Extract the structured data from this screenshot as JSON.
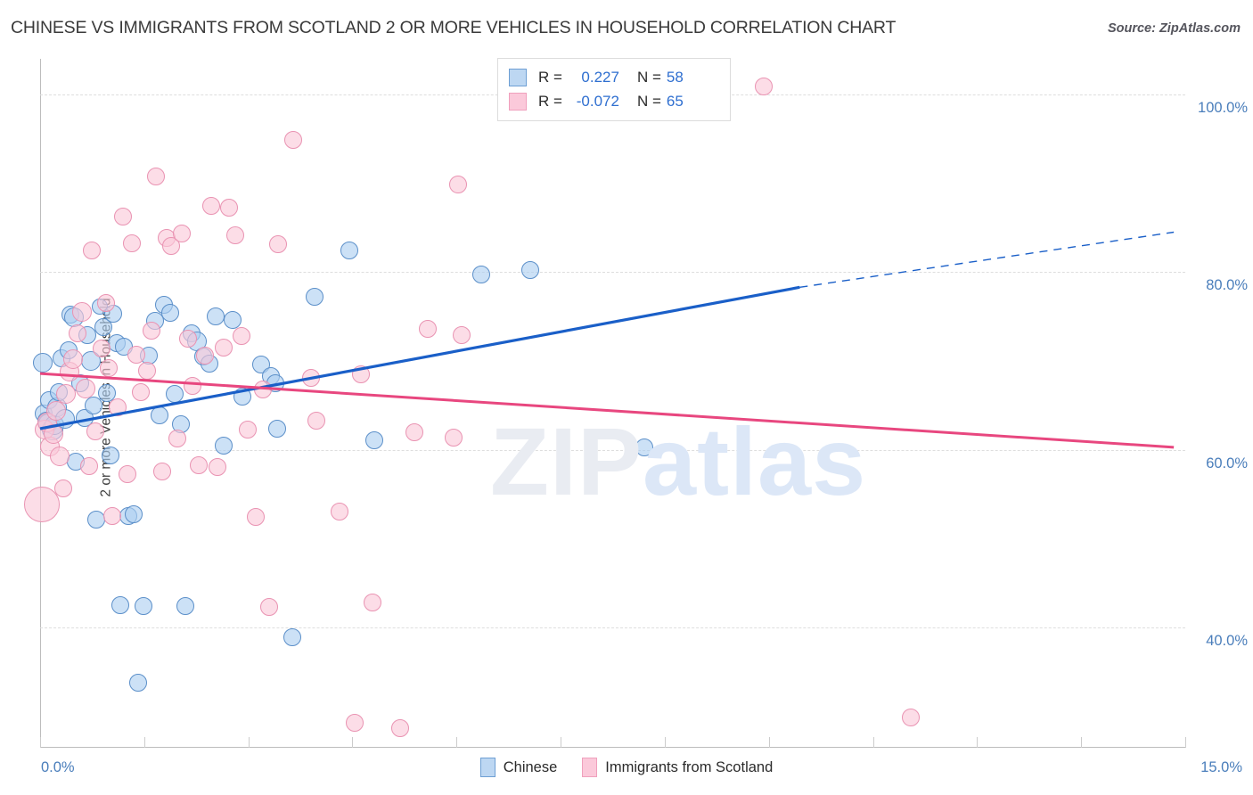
{
  "header": {
    "title": "CHINESE VS IMMIGRANTS FROM SCOTLAND 2 OR MORE VEHICLES IN HOUSEHOLD CORRELATION CHART",
    "source": "Source: ZipAtlas.com"
  },
  "watermark": {
    "part1": "ZIP",
    "part2": "atlas"
  },
  "stats": {
    "rows": [
      {
        "series": "Chinese",
        "r_label": "R =",
        "r_value": "0.227",
        "n_label": "N =",
        "n_value": "58",
        "color": "#bdd7f2"
      },
      {
        "series": "Immigrants from Scotland",
        "r_label": "R =",
        "r_value": "-0.072",
        "n_label": "N =",
        "n_value": "65",
        "color": "#fbc9da"
      }
    ]
  },
  "legend": {
    "items": [
      {
        "label": "Chinese",
        "color": "#bdd7f2"
      },
      {
        "label": "Immigrants from Scotland",
        "color": "#fbc9da"
      }
    ]
  },
  "axes": {
    "y_title": "2 or more Vehicles in Household",
    "y_ticks": [
      "100.0%",
      "80.0%",
      "60.0%",
      "40.0%"
    ],
    "x_min_label": "0.0%",
    "x_max_label": "15.0%"
  },
  "chart_data": {
    "type": "scatter",
    "title": "CHINESE VS IMMIGRANTS FROM SCOTLAND 2 OR MORE VEHICLES IN HOUSEHOLD CORRELATION CHART",
    "xlabel": "",
    "ylabel": "2 or more Vehicles in Household",
    "xlim": [
      0.0,
      15.0
    ],
    "ylim": [
      26.5,
      104.0
    ],
    "x_unit": "%",
    "y_unit": "%",
    "grid": true,
    "y_gridlines": [
      100.0,
      80.0,
      60.0,
      40.0
    ],
    "legend_position": "bottom-center",
    "series": [
      {
        "name": "Chinese",
        "color": "#bdd7f2",
        "edge_color": "#5b8fc9",
        "R": 0.227,
        "N": 58,
        "trendline": {
          "style": "solid-then-dashed",
          "color": "#1a5fc8",
          "solid_from": [
            0.0,
            62.4
          ],
          "solid_to": [
            9.95,
            78.3
          ],
          "dashed_to": [
            14.85,
            84.5
          ]
        },
        "points": [
          [
            0.03,
            69.8,
            11
          ],
          [
            0.05,
            64.1,
            10
          ],
          [
            0.08,
            63.3,
            10
          ],
          [
            0.1,
            63.0,
            11
          ],
          [
            0.12,
            65.6,
            10
          ],
          [
            0.16,
            62.3,
            12
          ],
          [
            0.19,
            62.8,
            11
          ],
          [
            0.22,
            64.8,
            11
          ],
          [
            0.25,
            66.5,
            10
          ],
          [
            0.28,
            70.3,
            10
          ],
          [
            0.33,
            63.5,
            11
          ],
          [
            0.37,
            71.2,
            10
          ],
          [
            0.4,
            75.2,
            10
          ],
          [
            0.44,
            74.9,
            11
          ],
          [
            0.47,
            58.7,
            10
          ],
          [
            0.52,
            67.5,
            10
          ],
          [
            0.58,
            63.6,
            10
          ],
          [
            0.62,
            72.9,
            10
          ],
          [
            0.66,
            70.0,
            11
          ],
          [
            0.7,
            65.0,
            10
          ],
          [
            0.74,
            52.2,
            10
          ],
          [
            0.78,
            76.1,
            9
          ],
          [
            0.83,
            73.8,
            10
          ],
          [
            0.87,
            66.4,
            10
          ],
          [
            0.92,
            59.4,
            10
          ],
          [
            0.96,
            75.3,
            10
          ],
          [
            1.0,
            72.0,
            10
          ],
          [
            1.05,
            42.5,
            10
          ],
          [
            1.1,
            71.6,
            10
          ],
          [
            1.16,
            52.6,
            10
          ],
          [
            1.22,
            52.8,
            10
          ],
          [
            1.28,
            33.8,
            10
          ],
          [
            1.35,
            42.4,
            10
          ],
          [
            1.42,
            70.6,
            10
          ],
          [
            1.5,
            74.5,
            10
          ],
          [
            1.56,
            63.9,
            10
          ],
          [
            1.62,
            76.3,
            10
          ],
          [
            1.7,
            75.4,
            10
          ],
          [
            1.76,
            66.3,
            10
          ],
          [
            1.84,
            62.9,
            10
          ],
          [
            1.9,
            42.4,
            10
          ],
          [
            1.98,
            73.1,
            10
          ],
          [
            2.05,
            72.2,
            11
          ],
          [
            2.14,
            70.5,
            10
          ],
          [
            2.22,
            69.7,
            10
          ],
          [
            2.3,
            75.0,
            10
          ],
          [
            2.4,
            60.5,
            10
          ],
          [
            2.52,
            74.6,
            10
          ],
          [
            2.65,
            66.0,
            10
          ],
          [
            2.9,
            69.6,
            10
          ],
          [
            3.02,
            68.3,
            10
          ],
          [
            3.08,
            67.5,
            10
          ],
          [
            3.1,
            62.4,
            10
          ],
          [
            3.3,
            38.9,
            10
          ],
          [
            3.6,
            77.2,
            10
          ],
          [
            4.05,
            82.4,
            10
          ],
          [
            4.38,
            61.1,
            10
          ],
          [
            5.78,
            79.7,
            10
          ],
          [
            6.42,
            80.2,
            10
          ],
          [
            7.92,
            60.3,
            10
          ]
        ]
      },
      {
        "name": "Immigrants from Scotland",
        "color": "#fbc9da",
        "edge_color": "#e993b2",
        "R": -0.072,
        "N": 65,
        "trendline": {
          "style": "solid",
          "color": "#e8477f",
          "from": [
            0.0,
            68.6
          ],
          "to": [
            14.85,
            60.3
          ]
        },
        "points": [
          [
            0.02,
            53.9,
            20
          ],
          [
            0.06,
            62.3,
            11
          ],
          [
            0.09,
            63.1,
            11
          ],
          [
            0.13,
            60.4,
            11
          ],
          [
            0.17,
            61.8,
            11
          ],
          [
            0.21,
            64.4,
            11
          ],
          [
            0.26,
            59.3,
            11
          ],
          [
            0.3,
            55.7,
            10
          ],
          [
            0.34,
            66.3,
            11
          ],
          [
            0.39,
            68.8,
            11
          ],
          [
            0.43,
            70.2,
            11
          ],
          [
            0.49,
            73.1,
            10
          ],
          [
            0.55,
            75.5,
            11
          ],
          [
            0.6,
            66.9,
            11
          ],
          [
            0.64,
            58.2,
            10
          ],
          [
            0.68,
            82.4,
            10
          ],
          [
            0.72,
            62.1,
            10
          ],
          [
            0.8,
            71.4,
            10
          ],
          [
            0.86,
            76.5,
            10
          ],
          [
            0.9,
            69.2,
            10
          ],
          [
            0.95,
            52.6,
            10
          ],
          [
            1.02,
            64.8,
            10
          ],
          [
            1.08,
            86.3,
            10
          ],
          [
            1.14,
            57.3,
            10
          ],
          [
            1.2,
            83.2,
            10
          ],
          [
            1.26,
            70.7,
            10
          ],
          [
            1.32,
            66.5,
            10
          ],
          [
            1.4,
            68.9,
            10
          ],
          [
            1.46,
            73.4,
            10
          ],
          [
            1.52,
            90.8,
            10
          ],
          [
            1.6,
            57.6,
            10
          ],
          [
            1.66,
            83.8,
            10
          ],
          [
            1.72,
            82.9,
            10
          ],
          [
            1.8,
            61.3,
            10
          ],
          [
            1.86,
            84.3,
            10
          ],
          [
            1.94,
            72.5,
            10
          ],
          [
            2.0,
            67.2,
            10
          ],
          [
            2.08,
            58.3,
            10
          ],
          [
            2.16,
            70.6,
            10
          ],
          [
            2.24,
            87.5,
            10
          ],
          [
            2.32,
            58.1,
            10
          ],
          [
            2.4,
            71.5,
            10
          ],
          [
            2.48,
            87.3,
            10
          ],
          [
            2.56,
            84.1,
            10
          ],
          [
            2.64,
            72.8,
            10
          ],
          [
            2.72,
            62.3,
            10
          ],
          [
            2.82,
            52.5,
            10
          ],
          [
            2.92,
            66.8,
            10
          ],
          [
            3.0,
            42.3,
            10
          ],
          [
            3.12,
            83.1,
            10
          ],
          [
            3.32,
            94.9,
            10
          ],
          [
            3.55,
            68.1,
            10
          ],
          [
            3.62,
            63.3,
            10
          ],
          [
            3.92,
            53.1,
            10
          ],
          [
            4.2,
            68.5,
            10
          ],
          [
            4.35,
            42.8,
            10
          ],
          [
            4.12,
            29.3,
            10
          ],
          [
            4.72,
            28.7,
            10
          ],
          [
            5.08,
            73.6,
            10
          ],
          [
            5.48,
            89.9,
            10
          ],
          [
            5.52,
            72.9,
            10
          ],
          [
            5.42,
            61.4,
            10
          ],
          [
            9.48,
            100.9,
            10
          ],
          [
            11.4,
            29.9,
            10
          ],
          [
            4.9,
            62.0,
            10
          ]
        ]
      }
    ]
  }
}
